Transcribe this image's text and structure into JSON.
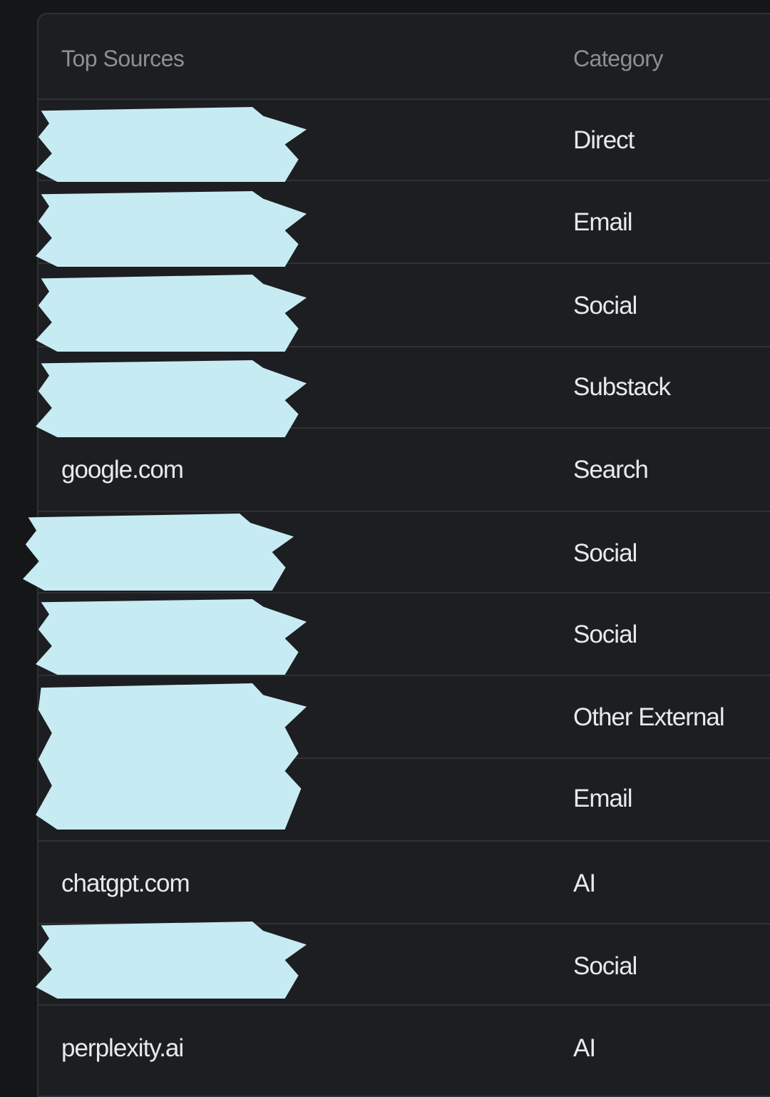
{
  "table": {
    "headers": {
      "source": "Top Sources",
      "category": "Category"
    },
    "rows": [
      {
        "source": "",
        "redacted": true,
        "category": "Direct"
      },
      {
        "source": "",
        "redacted": true,
        "category": "Email"
      },
      {
        "source": "",
        "redacted": true,
        "category": "Social"
      },
      {
        "source": "",
        "redacted": true,
        "category": "Substack"
      },
      {
        "source": "google.com",
        "redacted": false,
        "category": "Search"
      },
      {
        "source": "",
        "redacted": true,
        "category": "Social"
      },
      {
        "source": "",
        "redacted": true,
        "category": "Social"
      },
      {
        "source": "",
        "redacted": true,
        "category": "Other External"
      },
      {
        "source": "",
        "redacted": true,
        "category": "Email"
      },
      {
        "source": "chatgpt.com",
        "redacted": false,
        "category": "AI"
      },
      {
        "source": "",
        "redacted": true,
        "category": "Social"
      },
      {
        "source": "perplexity.ai",
        "redacted": false,
        "category": "AI"
      }
    ]
  },
  "colors": {
    "background": "#151618",
    "panel": "#1d1e21",
    "divider": "#2f3135",
    "header_text": "#8d8f94",
    "cell_text": "#e8e9eb",
    "redaction": "#c7ebf3"
  }
}
